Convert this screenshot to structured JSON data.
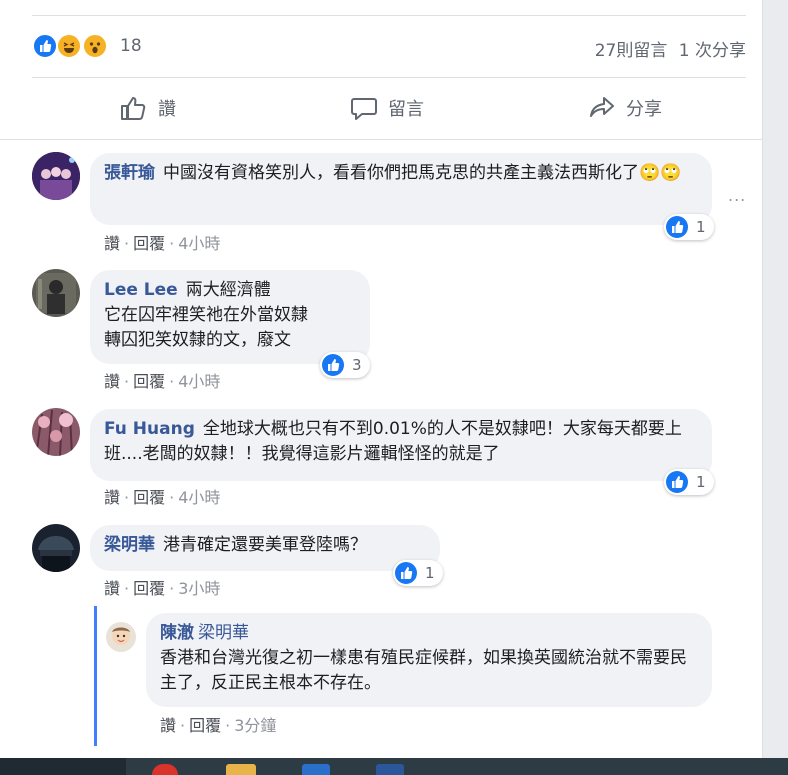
{
  "post_stats": {
    "reaction_count": "18",
    "comment_count": "27則留言",
    "share_count": "1 次分享",
    "reactions": [
      "like-icon",
      "haha-icon",
      "wow-icon"
    ]
  },
  "actions": {
    "like": "讚",
    "comment": "留言",
    "share": "分享"
  },
  "comments": [
    {
      "author": "張軒瑜",
      "text": "中國沒有資格笑別人，看看你們把馬克思的共產主義法西斯化了🙄🙄",
      "like_label": "讚",
      "reply_label": "回覆",
      "time": "4小時",
      "likes": "1"
    },
    {
      "author": "Lee Lee",
      "lines": [
        "兩大經濟體",
        "它在囚牢裡笑祂在外當奴隸",
        "轉囚犯笑奴隸的文，廢文"
      ],
      "like_label": "讚",
      "reply_label": "回覆",
      "time": "4小時",
      "likes": "3"
    },
    {
      "author": "Fu Huang",
      "text": "全地球大概也只有不到0.01%的人不是奴隸吧！大家每天都要上班....老闆的奴隸！！我覺得這影片邏輯怪怪的就是了",
      "like_label": "讚",
      "reply_label": "回覆",
      "time": "4小時",
      "likes": "1"
    },
    {
      "author": "梁明華",
      "text": "港青確定還要美軍登陸嗎？",
      "like_label": "讚",
      "reply_label": "回覆",
      "time": "3小時",
      "likes": "1"
    }
  ],
  "reply": {
    "author": "陳澈",
    "mention": "梁明華",
    "text": "香港和台灣光復之初一樣患有殖民症候群，如果換英國統治就不需要民主了，反正民主根本不存在。",
    "like_label": "讚",
    "reply_label": "回覆",
    "time": "3分鐘"
  },
  "more_options": "...",
  "colors": {
    "link": "#385898",
    "like_blue": "#1877f2",
    "bubble": "#f0f2f5",
    "reply_line": "#4080ff"
  }
}
